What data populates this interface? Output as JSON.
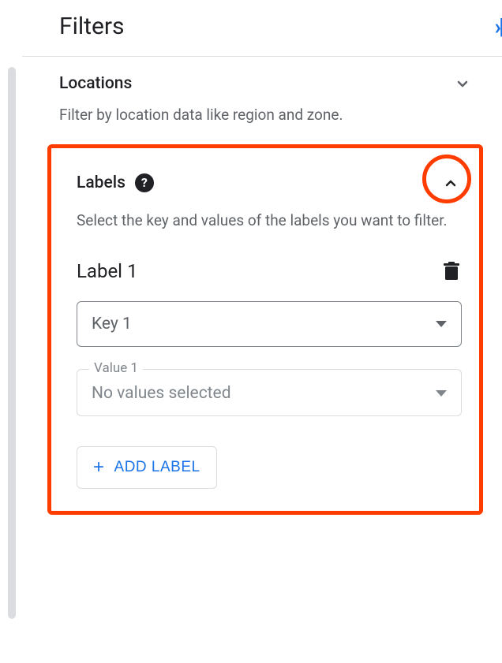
{
  "header": {
    "title": "Filters"
  },
  "locations": {
    "title": "Locations",
    "description": "Filter by location data like region and zone."
  },
  "labels": {
    "title": "Labels",
    "description": "Select the key and values of the labels you want to filter.",
    "item": {
      "title": "Label 1",
      "key_placeholder": "Key 1",
      "value_label": "Value 1",
      "value_placeholder": "No values selected"
    },
    "add_button": "ADD LABEL"
  }
}
